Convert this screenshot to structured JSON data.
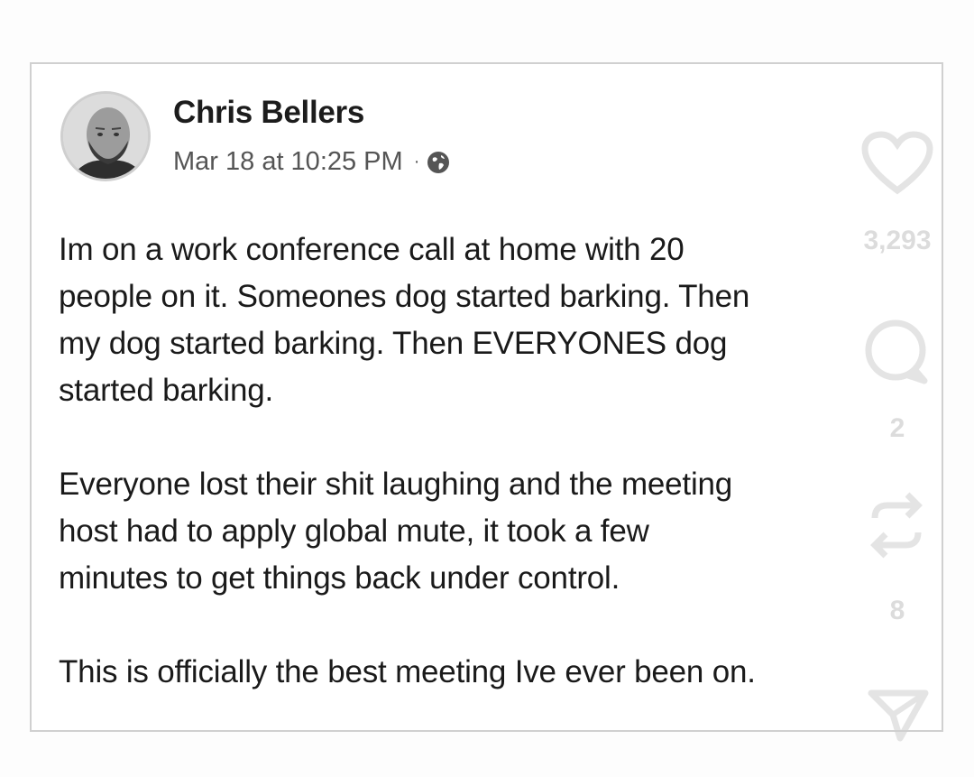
{
  "post": {
    "author": "Chris Bellers",
    "timestamp": "Mar 18 at 10:25 PM",
    "separator": "·",
    "privacy_icon": "globe-icon",
    "paragraphs": [
      "Im on a work conference call at home with 20\npeople on it.  Someones dog started barking.  Then\nmy dog started barking. Then EVERYONES dog\nstarted barking.",
      "Everyone lost their shit laughing and the meeting\nhost had to apply global mute, it took a few\nminutes to get things back under control.",
      "This is officially the best meeting Ive ever been on."
    ]
  },
  "overlay_actions": {
    "like_icon": "heart-icon",
    "like_count": "3,293",
    "comment_icon": "comment-icon",
    "comment_count": "2",
    "repost_icon": "repost-icon",
    "repost_count": "8",
    "share_icon": "send-icon"
  },
  "colors": {
    "border": "#d0d0d0",
    "text": "#1a1a1a",
    "meta_text": "#555555",
    "overlay": "#d9d9d9"
  }
}
